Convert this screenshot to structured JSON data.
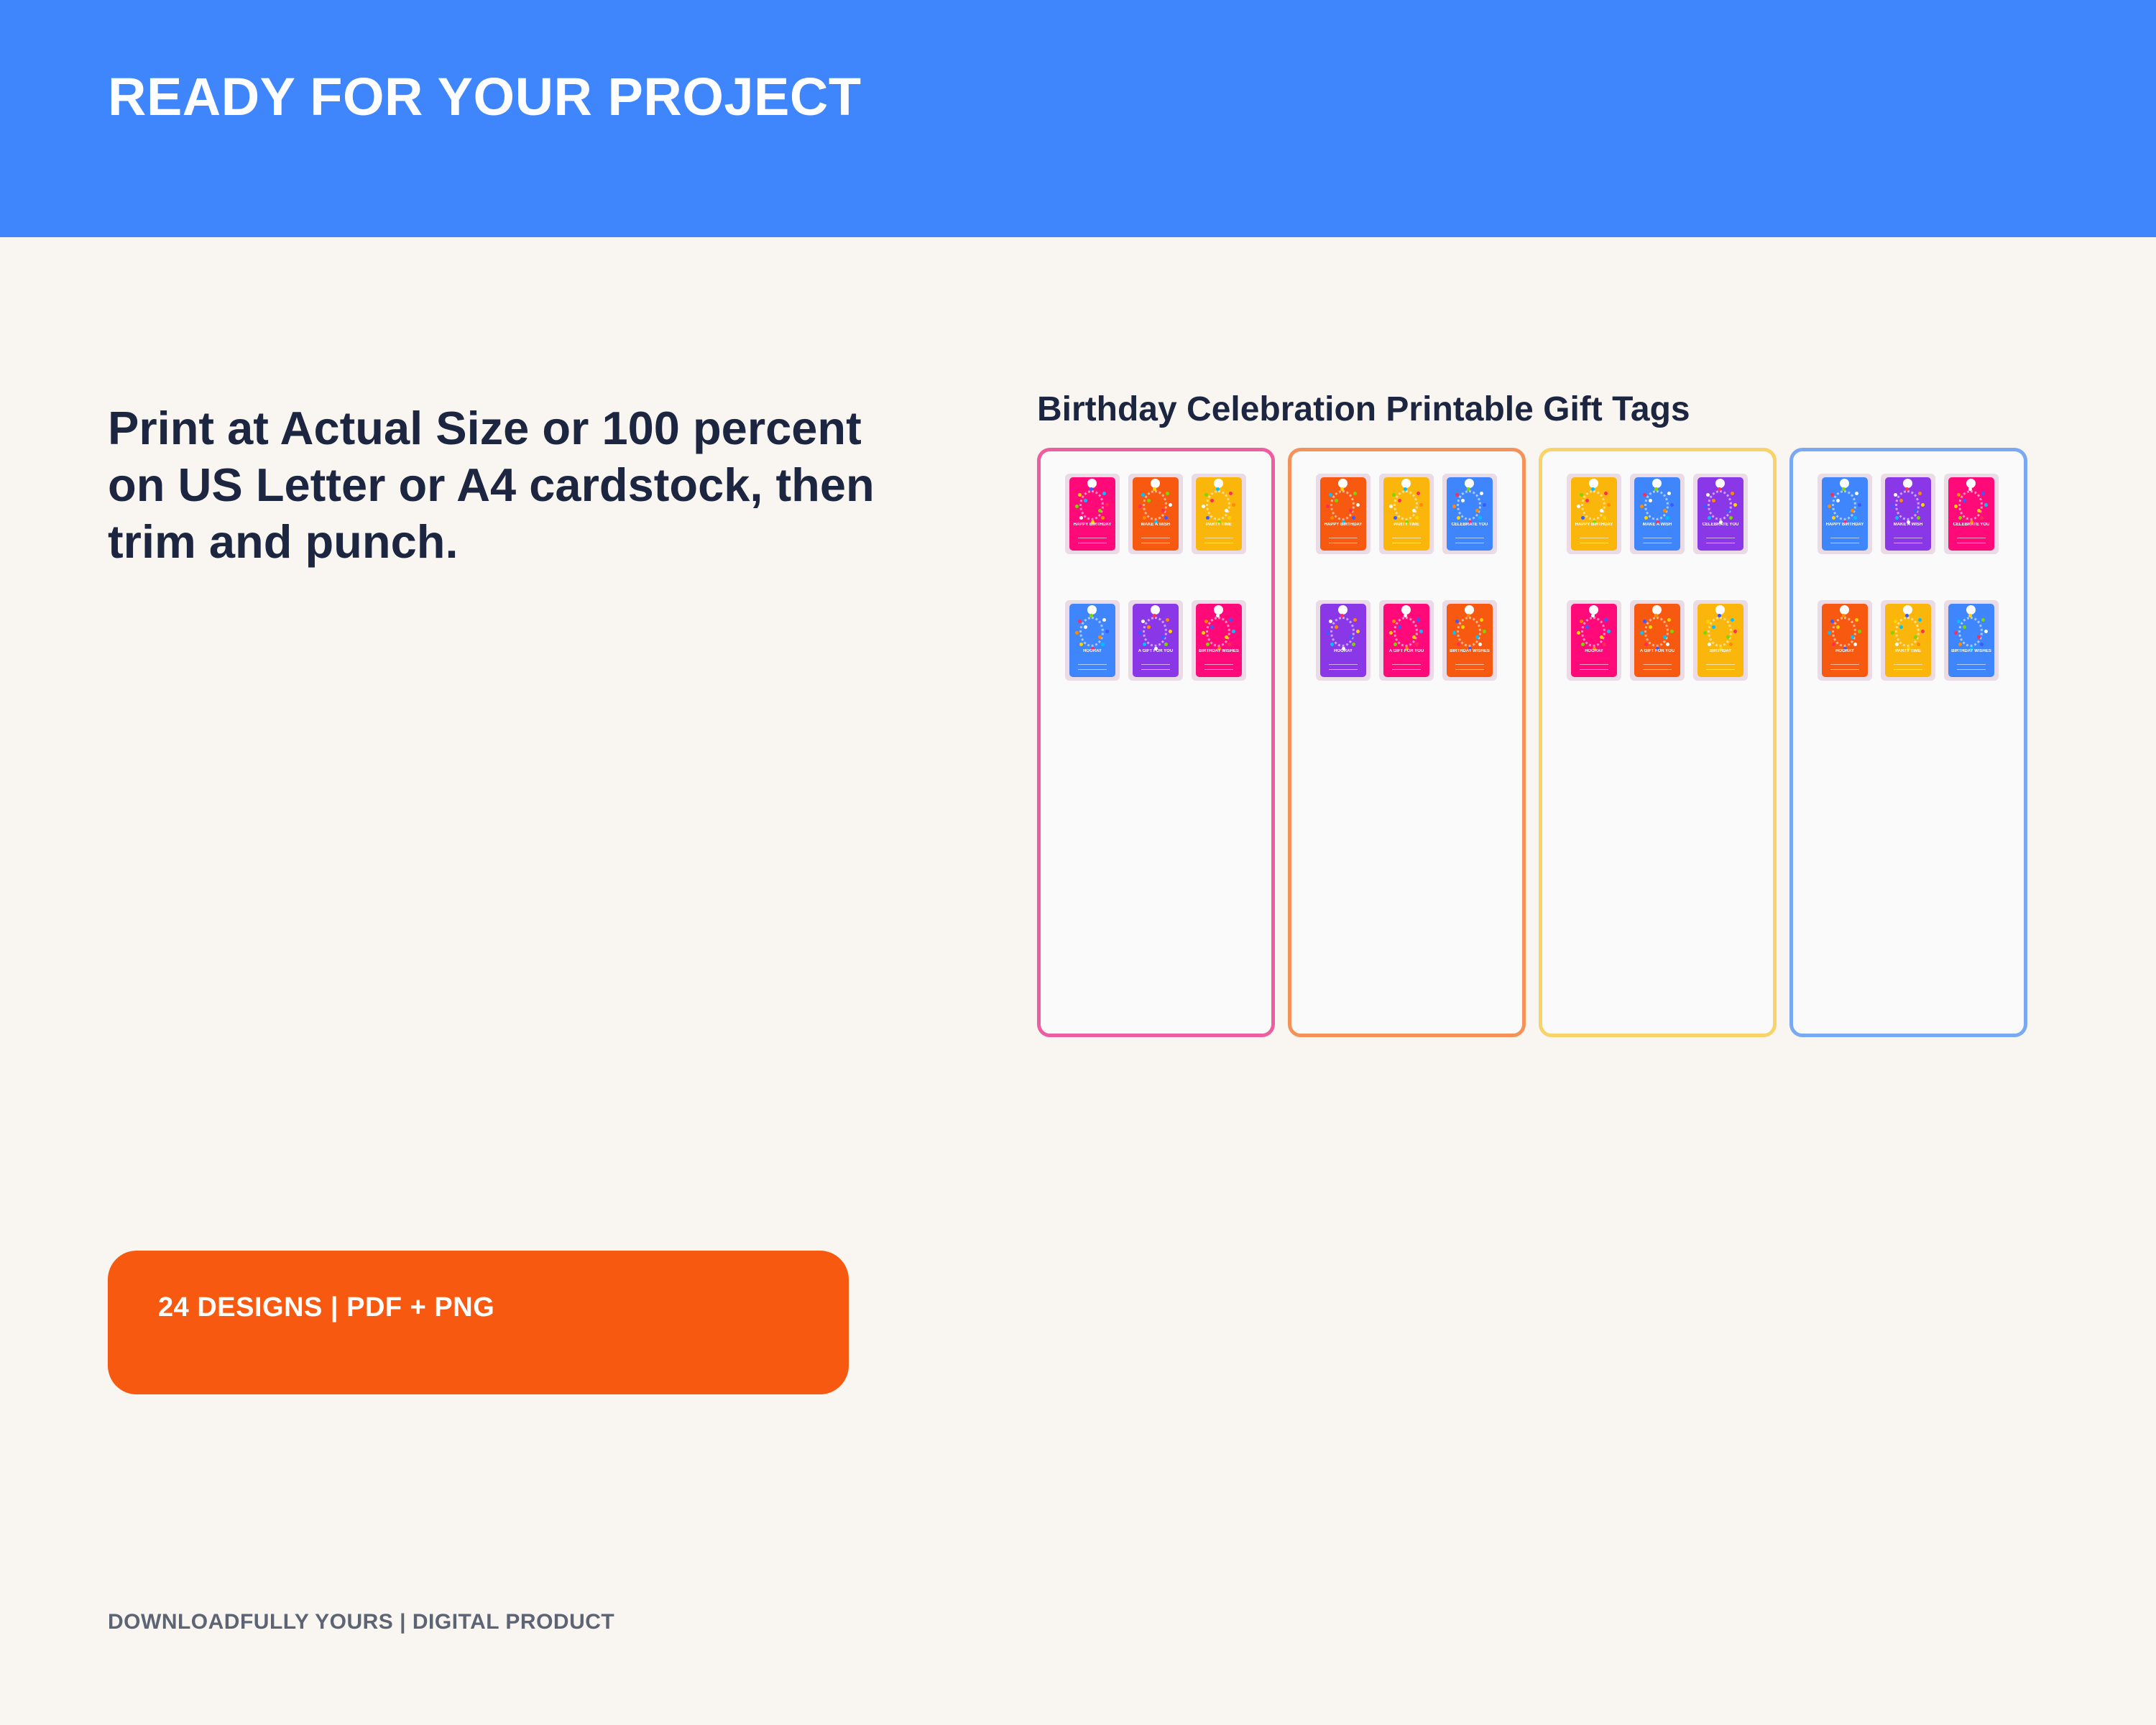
{
  "header": {
    "title": "READY FOR YOUR PROJECT",
    "background_color": "#3f86fc"
  },
  "instructions": {
    "text": "Print at Actual Size or 100 percent on US Letter or A4 cardstock, then trim and punch."
  },
  "preview": {
    "title": "Birthday Celebration Printable Gift Tags",
    "sheets": [
      {
        "border_color": "#ec5e9f",
        "tags": [
          {
            "color": "#ff0a78",
            "text": "HAPPY BIRTHDAY"
          },
          {
            "color": "#f75910",
            "text": "MAKE A WISH"
          },
          {
            "color": "#fbb60c",
            "text": "PARTY TIME"
          },
          {
            "color": "#3f86fc",
            "text": "HOORAY"
          },
          {
            "color": "#8a37e8",
            "text": "A GIFT FOR YOU"
          },
          {
            "color": "#ff0a78",
            "text": "BIRTHDAY WISHES"
          }
        ]
      },
      {
        "border_color": "#f4925a",
        "tags": [
          {
            "color": "#f75910",
            "text": "HAPPY BIRTHDAY"
          },
          {
            "color": "#fbb60c",
            "text": "PARTY TIME"
          },
          {
            "color": "#3f86fc",
            "text": "CELEBRATE YOU"
          },
          {
            "color": "#8a37e8",
            "text": "HOORAY"
          },
          {
            "color": "#ff0a78",
            "text": "A GIFT FOR YOU"
          },
          {
            "color": "#f75910",
            "text": "BIRTHDAY WISHES"
          }
        ]
      },
      {
        "border_color": "#f8d36a",
        "tags": [
          {
            "color": "#fbb60c",
            "text": "HAPPY BIRTHDAY"
          },
          {
            "color": "#3f86fc",
            "text": "MAKE A WISH"
          },
          {
            "color": "#8a37e8",
            "text": "CELEBRATE YOU"
          },
          {
            "color": "#ff0a78",
            "text": "HOORAY"
          },
          {
            "color": "#f75910",
            "text": "A GIFT FOR YOU"
          },
          {
            "color": "#fbb60c",
            "text": "BIRTHDAY"
          }
        ]
      },
      {
        "border_color": "#7aa9f4",
        "tags": [
          {
            "color": "#3f86fc",
            "text": "HAPPY BIRTHDAY"
          },
          {
            "color": "#8a37e8",
            "text": "MAKE A WISH"
          },
          {
            "color": "#ff0a78",
            "text": "CELEBRATE YOU"
          },
          {
            "color": "#f75910",
            "text": "HOORAY"
          },
          {
            "color": "#fbb60c",
            "text": "PARTY TIME"
          },
          {
            "color": "#3f86fc",
            "text": "BIRTHDAY WISHES"
          }
        ]
      }
    ]
  },
  "badge": {
    "label": "24 DESIGNS | PDF + PNG",
    "background_color": "#f75910"
  },
  "footer": {
    "text": "DOWNLOADFULLY YOURS | DIGITAL PRODUCT"
  }
}
